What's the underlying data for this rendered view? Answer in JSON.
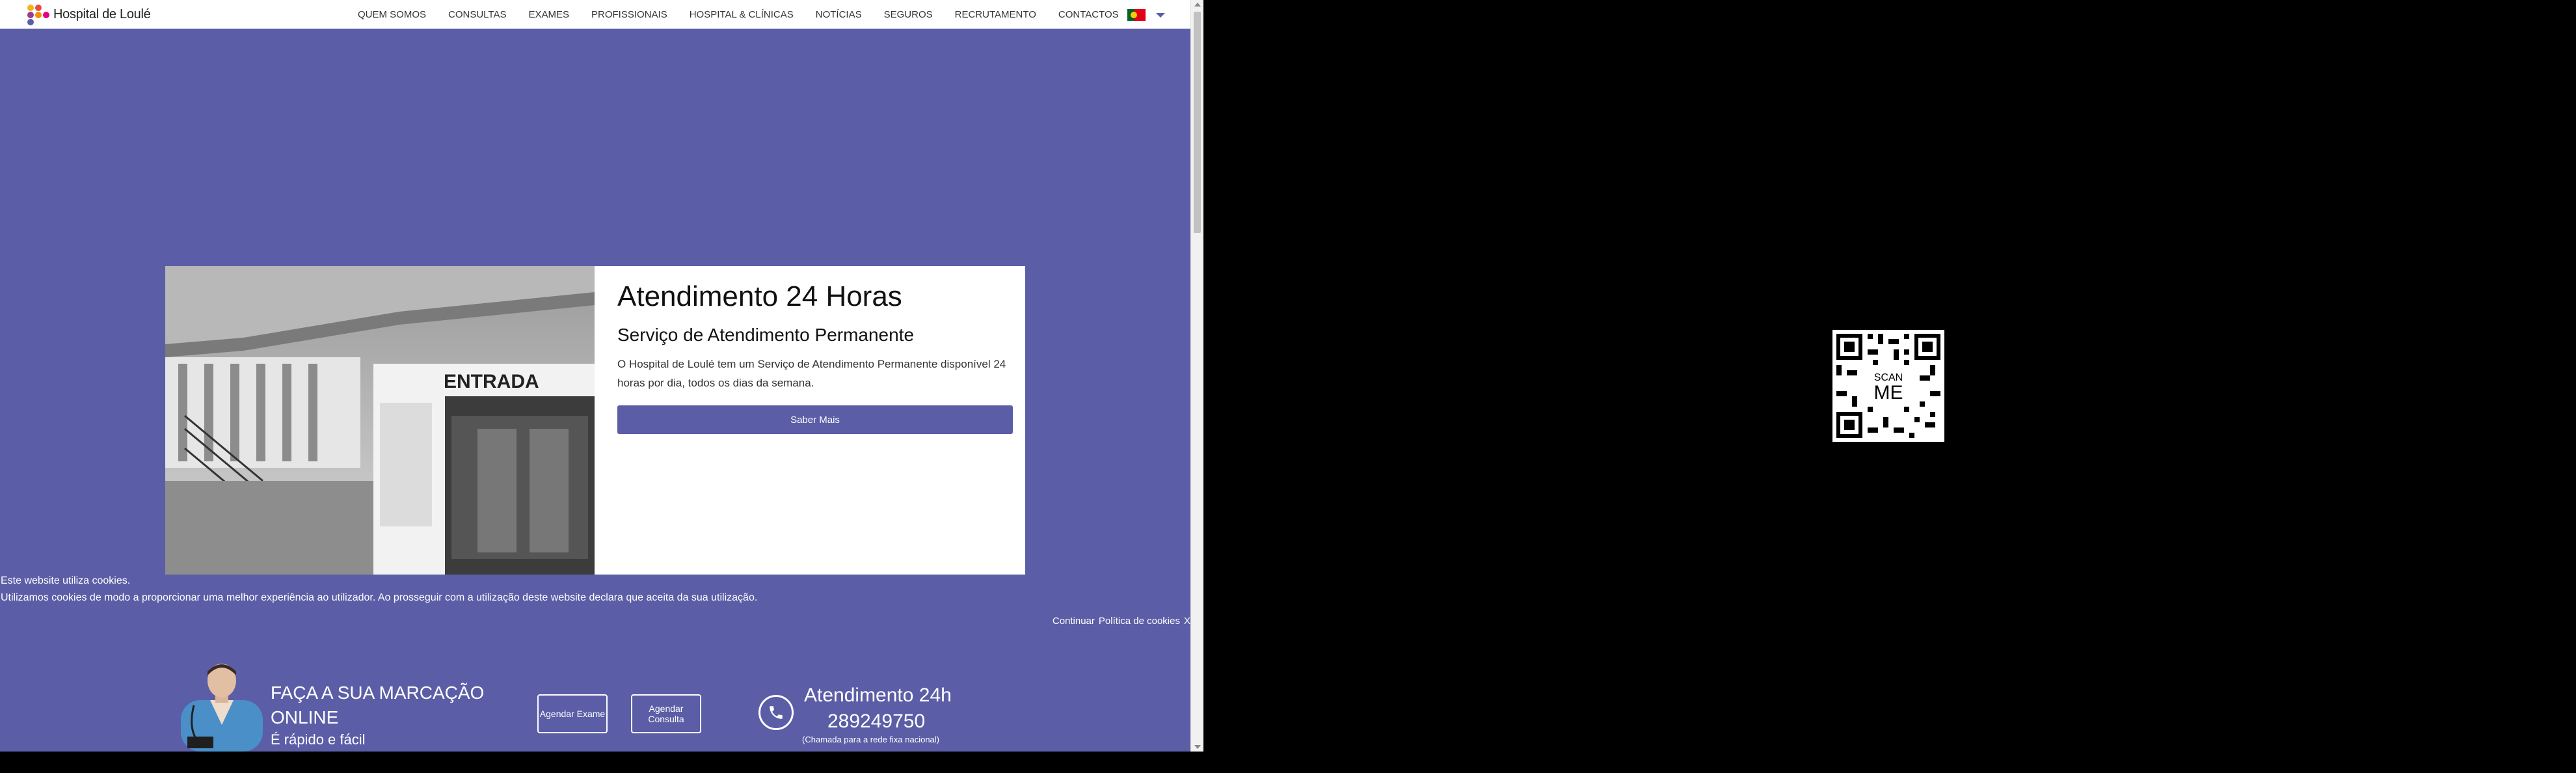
{
  "header": {
    "logo_text": "Hospital de Loulé",
    "nav": [
      "QUEM SOMOS",
      "CONSULTAS",
      "EXAMES",
      "PROFISSIONAIS",
      "HOSPITAL & CLÍNICAS",
      "NOTÍCIAS",
      "SEGUROS",
      "RECRUTAMENTO",
      "CONTACTOS"
    ],
    "language": "pt-flag-icon"
  },
  "hero": {
    "title": "Atendimento 24 Horas",
    "subtitle": "Serviço de Atendimento Permanente",
    "text": "O Hospital de Loulé tem um Serviço de Atendimento Permanente disponível 24 horas por dia, todos os dias da semana.",
    "button": "Saber Mais",
    "image_sign": "ENTRADA"
  },
  "cookie": {
    "title": "Este website utiliza cookies.",
    "text": "Utilizamos cookies de modo a proporcionar uma melhor experiência ao utilizador. Ao prosseguir com a utilização deste website declara que aceita da sua utilização.",
    "continue": "Continuar",
    "policy": "Política de cookies",
    "close": "X"
  },
  "booking": {
    "title": "FAÇA A SUA MARCAÇÃO ONLINE",
    "subtitle": "É rápido e fácil",
    "btn_exame": "Agendar Exame",
    "btn_consulta": "Agendar Consulta",
    "attendance_title": "Atendimento 24h",
    "phone": "289249750",
    "phone_note": "(Chamada para a rede fixa nacional)"
  },
  "qr": {
    "label_top": "SCAN",
    "label_bottom": "ME"
  },
  "colors": {
    "brand": "#5b5ea6",
    "background": "#000000"
  }
}
